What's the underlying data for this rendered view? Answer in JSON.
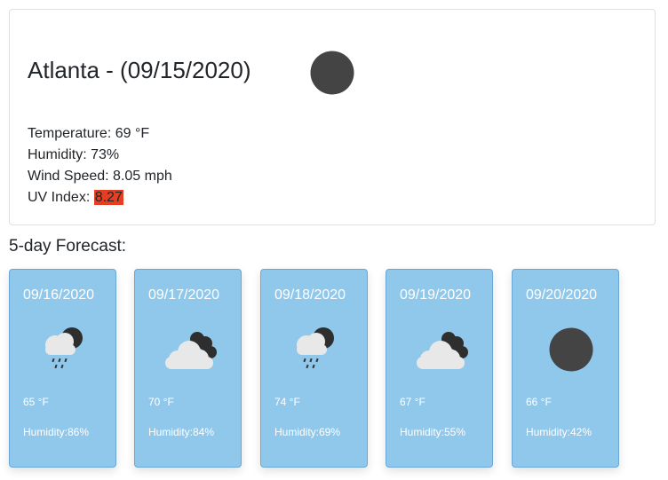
{
  "current": {
    "city_title": "Atlanta - (09/15/2020)",
    "icon": "moon-circle-icon",
    "temperature": "Temperature: 69 °F",
    "humidity": "Humidity: 73%",
    "wind_speed": "Wind Speed: 8.05 mph",
    "uv_label": "UV Index: ",
    "uv_value": "8.27",
    "uv_color": "#e53e21"
  },
  "forecast": {
    "heading": "5-day Forecast:",
    "card_color": "#90c8ec",
    "days": [
      {
        "date": "09/16/2020",
        "icon": "rain-cloud-night-icon",
        "temp": "65 °F",
        "humidity": "Humidity:86%"
      },
      {
        "date": "09/17/2020",
        "icon": "cloudy-night-icon",
        "temp": "70 °F",
        "humidity": "Humidity:84%"
      },
      {
        "date": "09/18/2020",
        "icon": "rain-cloud-night-icon",
        "temp": "74 °F",
        "humidity": "Humidity:69%"
      },
      {
        "date": "09/19/2020",
        "icon": "cloudy-night-icon",
        "temp": "67 °F",
        "humidity": "Humidity:55%"
      },
      {
        "date": "09/20/2020",
        "icon": "moon-circle-icon",
        "temp": "66 °F",
        "humidity": "Humidity:42%"
      }
    ]
  }
}
